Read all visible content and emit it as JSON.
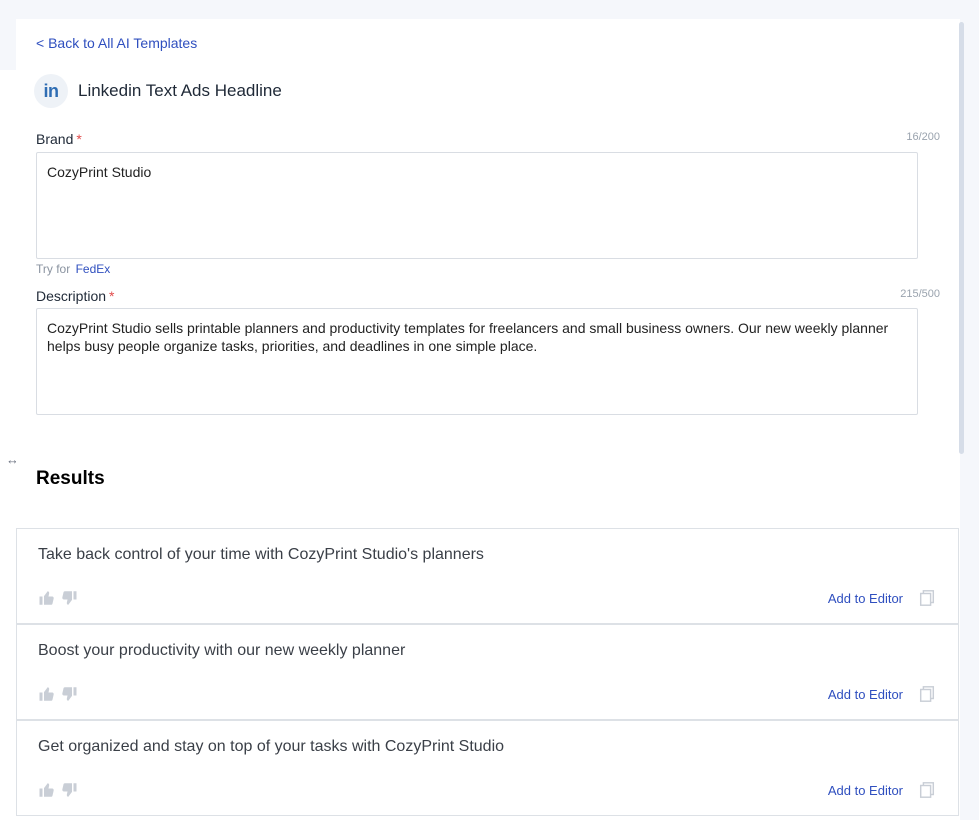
{
  "back_link": "< Back to All AI Templates",
  "template": {
    "icon_label": "in",
    "title": "Linkedin Text Ads Headline"
  },
  "brand": {
    "label": "Brand",
    "required_mark": "*",
    "counter": "16/200",
    "value": "CozyPrint Studio",
    "try_for_prefix": "Try for",
    "try_for_example": "FedEx"
  },
  "description": {
    "label": "Description",
    "required_mark": "*",
    "counter": "215/500",
    "value": "CozyPrint Studio sells printable planners and productivity templates for freelancers and small business owners. Our new weekly planner helps busy people organize tasks, priorities, and deadlines in one simple place."
  },
  "results": {
    "title": "Results",
    "add_to_editor_label": "Add to Editor",
    "items": [
      {
        "text": "Take back control of your time with CozyPrint Studio's planners"
      },
      {
        "text": "Boost your productivity with our new weekly planner"
      },
      {
        "text": "Get organized and stay on top of your tasks with CozyPrint Studio"
      }
    ]
  },
  "icons": {
    "linkedin": "linkedin-icon",
    "thumbs_up": "thumbs-up-icon",
    "thumbs_down": "thumbs-down-icon",
    "copy": "copy-icon",
    "resize": "resize-handle-icon"
  },
  "colors": {
    "link": "#2f4fbf",
    "required": "#e14b4b",
    "linkedin": "#2f6db3"
  }
}
